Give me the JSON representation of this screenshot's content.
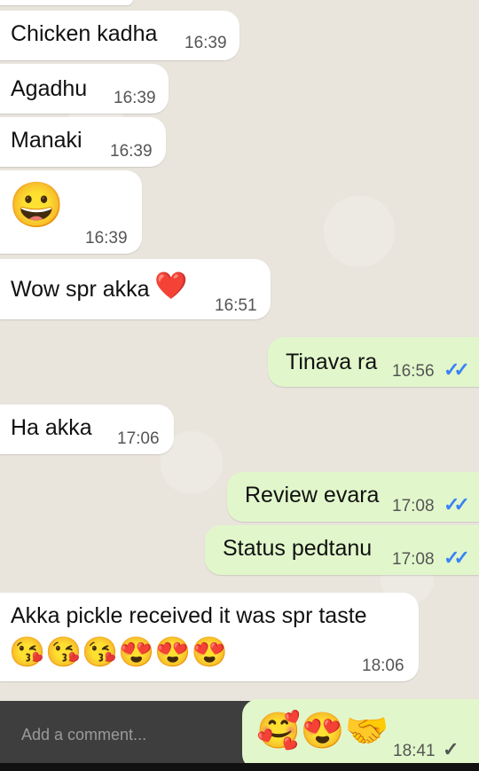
{
  "messages": [
    {
      "text": "Chicken kadha",
      "time": "16:39"
    },
    {
      "text": "Agadhu",
      "time": "16:39"
    },
    {
      "text": "Manaki",
      "time": "16:39"
    },
    {
      "emoji": "😀",
      "time": "16:39"
    },
    {
      "text": "Wow spr akka",
      "emoji": "❤️",
      "time": "16:51"
    },
    {
      "text": "Tinava ra",
      "time": "16:56"
    },
    {
      "text": "Ha akka",
      "time": "17:06"
    },
    {
      "text": "Review evara",
      "time": "17:08"
    },
    {
      "text": "Status pedtanu",
      "time": "17:08"
    },
    {
      "text": "Akka pickle received it was spr taste",
      "emoji": "😘😘😘😍😍😍",
      "time": "18:06"
    },
    {
      "emoji": "🥰😍🤝",
      "time": "18:41"
    }
  ],
  "comment": {
    "placeholder": "Add a comment..."
  },
  "colors": {
    "incoming": "#ffffff",
    "outgoing": "#e1f7cb",
    "read_tick": "#3b82f6",
    "wallpaper": "#e9e4dc"
  }
}
